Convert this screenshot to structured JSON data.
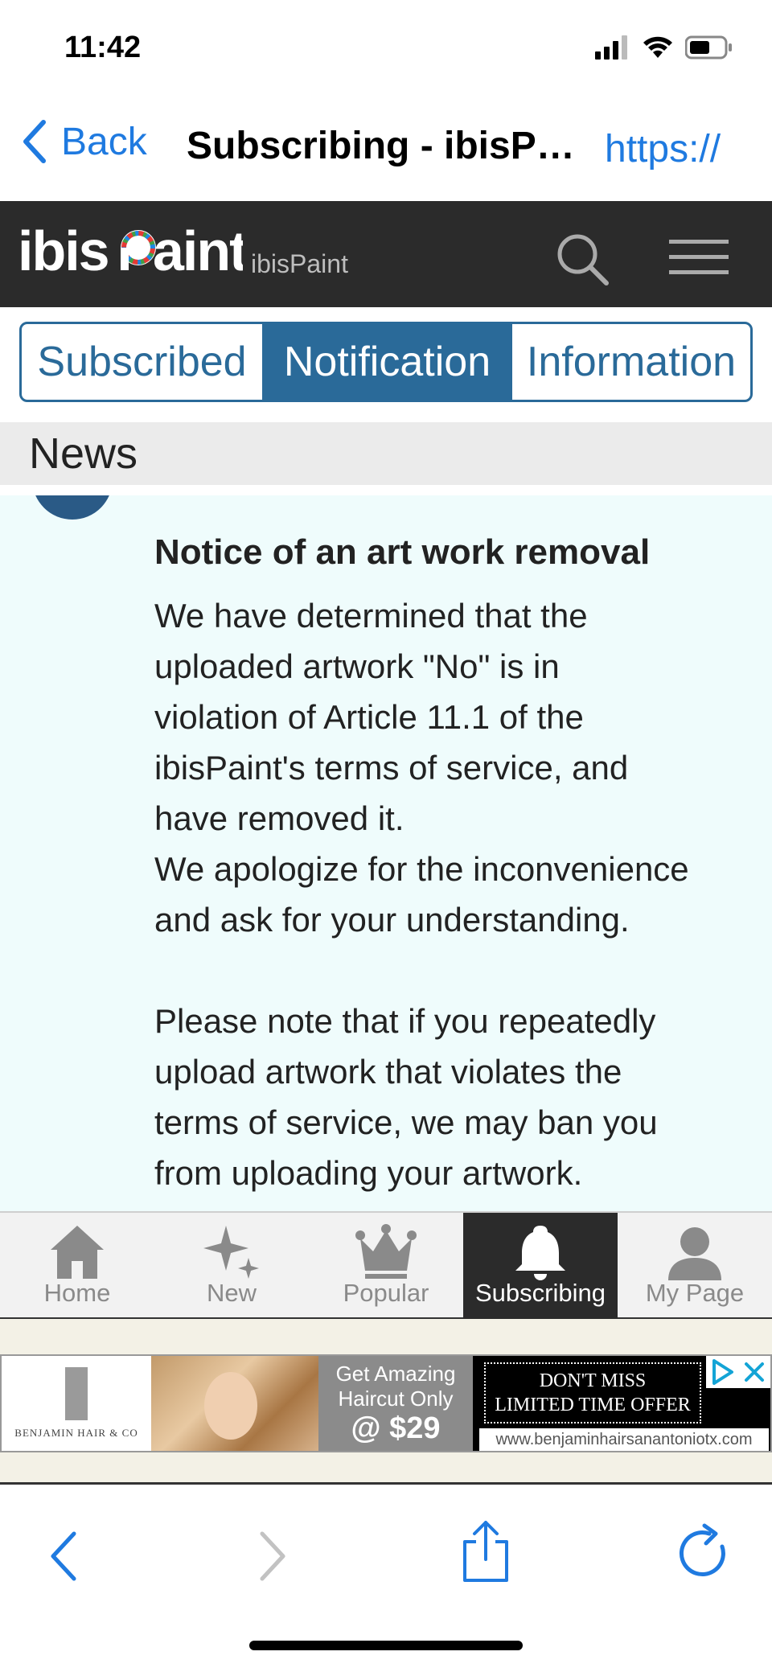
{
  "status_bar": {
    "time": "11:42"
  },
  "nav": {
    "back_label": "Back",
    "title": "Subscribing - ibisPaint",
    "url": "https://"
  },
  "site": {
    "logo_text": "ibisPaint",
    "logo_subtitle": "ibisPaint"
  },
  "tabs": [
    {
      "label": "Subscribed",
      "active": false
    },
    {
      "label": "Notification",
      "active": true
    },
    {
      "label": "Information",
      "active": false
    }
  ],
  "section": {
    "title": "News"
  },
  "notice": {
    "title": "Notice of an art work removal",
    "lines": [
      "We have determined that the",
      "uploaded artwork \"No\" is in",
      "violation of Article 11.1 of the",
      "ibisPaint's terms of service, and",
      "have removed it.",
      "We apologize for the inconvenience",
      "and ask for your understanding.",
      "",
      "Please note that if you repeatedly",
      "upload artwork that violates the",
      "terms of service, we may ban you",
      "from uploading your artwork."
    ]
  },
  "bottom_tabs": [
    {
      "label": "Home",
      "icon": "home-icon",
      "active": false
    },
    {
      "label": "New",
      "icon": "sparkle-icon",
      "active": false
    },
    {
      "label": "Popular",
      "icon": "crown-icon",
      "active": false
    },
    {
      "label": "Subscribing",
      "icon": "bell-icon",
      "active": true
    },
    {
      "label": "My Page",
      "icon": "person-icon",
      "active": false
    }
  ],
  "ad": {
    "brand": "BENJAMIN HAIR & CO",
    "line1": "Get Amazing",
    "line2": "Haircut Only",
    "price": "@ $29",
    "offer1": "DON'T MISS",
    "offer2": "LIMITED TIME OFFER",
    "url": "www.benjaminhairsanantoniotx.com"
  },
  "colors": {
    "accent": "#1f7ae0",
    "brand_blue": "#2a6a99",
    "header_dark": "#2b2b2b",
    "content_bg": "#effcfc"
  }
}
